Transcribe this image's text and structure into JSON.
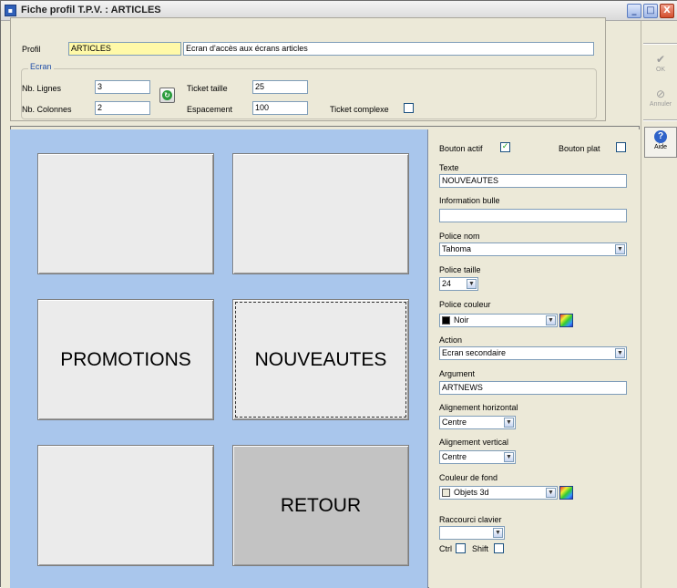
{
  "window": {
    "title": "Fiche profil T.P.V. : ARTICLES",
    "controls": {
      "minimize": "_",
      "maximize": "□",
      "close": "X"
    }
  },
  "sidebar": {
    "ok": {
      "label": "OK",
      "icon": "checkmark-icon"
    },
    "cancel": {
      "label": "Annuler",
      "icon": "cancel-icon"
    },
    "help": {
      "label": "Aide",
      "icon": "help-icon"
    }
  },
  "profile": {
    "label": "Profil",
    "code": "ARTICLES",
    "description": "Ecran d'accès aux écrans articles"
  },
  "screen": {
    "group_title": "Ecran",
    "rows_label": "Nb. Lignes",
    "rows_value": "3",
    "cols_label": "Nb. Colonnes",
    "cols_value": "2",
    "ticket_size_label": "Ticket taille",
    "ticket_size_value": "25",
    "spacing_label": "Espacement",
    "spacing_value": "100",
    "complex_ticket_label": "Ticket complexe",
    "complex_ticket_checked": false
  },
  "tiles": [
    {
      "text": "",
      "style": "normal"
    },
    {
      "text": "",
      "style": "normal"
    },
    {
      "text": "PROMOTIONS",
      "style": "normal"
    },
    {
      "text": "NOUVEAUTES",
      "style": "selected"
    },
    {
      "text": "",
      "style": "normal"
    },
    {
      "text": "RETOUR",
      "style": "grey"
    }
  ],
  "properties": {
    "active_label": "Bouton actif",
    "active_checked": true,
    "flat_label": "Bouton plat",
    "flat_checked": false,
    "text_label": "Texte",
    "text_value": "NOUVEAUTES",
    "tooltip_label": "Information bulle",
    "tooltip_value": "",
    "font_name_label": "Police nom",
    "font_name_value": "Tahoma",
    "font_size_label": "Police taille",
    "font_size_value": "24",
    "font_color_label": "Police couleur",
    "font_color_value": "Noir",
    "font_color_swatch": "#000000",
    "action_label": "Action",
    "action_value": "Ecran secondaire",
    "argument_label": "Argument",
    "argument_value": "ARTNEWS",
    "halign_label": "Alignement horizontal",
    "halign_value": "Centre",
    "valign_label": "Alignement vertical",
    "valign_value": "Centre",
    "bg_color_label": "Couleur de fond",
    "bg_color_value": "Objets 3d",
    "bg_color_swatch": "#ece9d8",
    "shortcut_label": "Raccourci clavier",
    "shortcut_value": "",
    "ctrl_label": "Ctrl",
    "ctrl_checked": false,
    "shift_label": "Shift",
    "shift_checked": false
  }
}
